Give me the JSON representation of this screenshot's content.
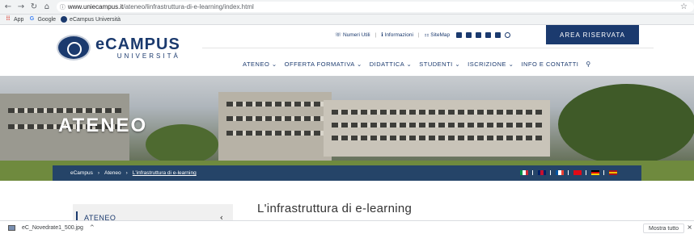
{
  "browser": {
    "url_host": "www.uniecampus.it",
    "url_path": "/ateneo/linfrastruttura-di-e-learning/index.html",
    "bookmarks": [
      "App",
      "Google",
      "eCampus Università"
    ]
  },
  "header": {
    "logo_name": "eCAMPUS",
    "logo_sub": "UNIVERSITÀ",
    "utility": [
      "Numeri Utili",
      "Informazioni",
      "SiteMap"
    ],
    "area_button": "AREA RISERVATA",
    "nav": [
      "ATENEO",
      "OFFERTA FORMATIVA",
      "DIDATTICA",
      "STUDENTI",
      "ISCRIZIONE",
      "INFO E CONTATTI"
    ]
  },
  "hero": {
    "title": "ATENEO",
    "breadcrumb": [
      "eCampus",
      "Ateneo",
      "L'infrastruttura di e-learning"
    ]
  },
  "sidebar": {
    "label": "ATENEO"
  },
  "main": {
    "title": "L'infrastruttura di e-learning"
  },
  "download": {
    "filename": "eC_Novedrate1_500.jpg",
    "show_all": "Mostra tutto"
  },
  "colors": {
    "brand": "#1b3a6e"
  }
}
